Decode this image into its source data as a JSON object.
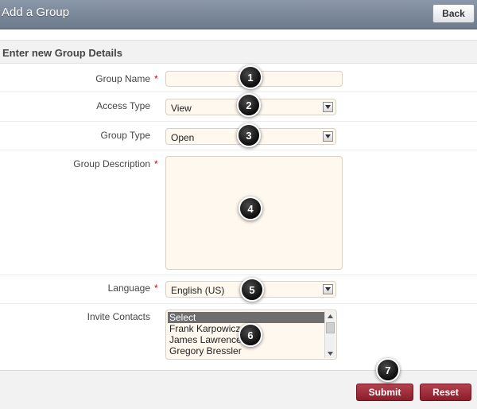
{
  "header": {
    "title": "Add a Group",
    "back_label": "Back"
  },
  "section": {
    "title": "Enter new Group Details"
  },
  "form": {
    "group_name": {
      "label": "Group Name",
      "required_mark": "*",
      "value": ""
    },
    "access_type": {
      "label": "Access Type",
      "value": "View"
    },
    "group_type": {
      "label": "Group Type",
      "value": "Open"
    },
    "group_description": {
      "label": "Group Description",
      "required_mark": "*",
      "value": ""
    },
    "language": {
      "label": "Language",
      "required_mark": "*",
      "value": "English (US)"
    },
    "invite_contacts": {
      "label": "Invite Contacts",
      "options": [
        "Select",
        "Frank Karpowicz",
        "James Lawrence",
        "Gregory Bressler"
      ],
      "selected_index": 0
    }
  },
  "footer": {
    "submit_label": "Submit",
    "reset_label": "Reset"
  },
  "callouts": [
    "1",
    "2",
    "3",
    "4",
    "5",
    "6",
    "7"
  ],
  "colors": {
    "header_bg": "#7b8799",
    "input_bg": "#fff8ee",
    "required": "#d0021b",
    "button_red": "#9e2f3b",
    "list_selected": "#6e6e6e"
  }
}
